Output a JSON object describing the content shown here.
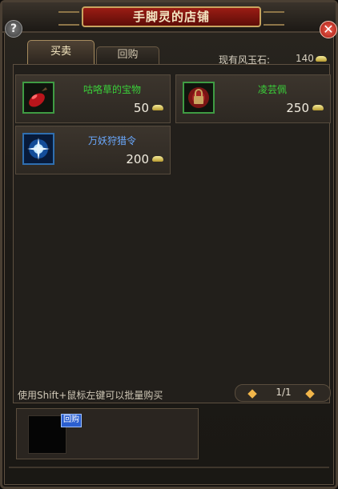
{
  "window": {
    "title": "手脚灵的店铺"
  },
  "controls": {
    "help_label": "?",
    "close_label": "✕"
  },
  "tabs": [
    {
      "label": "买卖",
      "active": true
    },
    {
      "label": "回购",
      "active": false
    }
  ],
  "currency": {
    "label": "现有风玉石:",
    "value": "140",
    "icon": "jade-ingot-icon"
  },
  "items": [
    {
      "name": "咕咯草的宝物",
      "price": "50",
      "name_color": "#3ad13a",
      "icon": "red-bundle-icon"
    },
    {
      "name": "凌芸佩",
      "price": "250",
      "name_color": "#3ad13a",
      "icon": "locked-pendant-icon"
    },
    {
      "name": "万妖狩猎令",
      "price": "200",
      "name_color": "#6aa9ff",
      "icon": "blue-star-token-icon"
    }
  ],
  "hint": "使用Shift+鼠标左键可以批量购买",
  "pagination": {
    "text": "1/1",
    "prev_icon": "◆",
    "next_icon": "◆"
  },
  "buyback": {
    "badge": "回购"
  }
}
